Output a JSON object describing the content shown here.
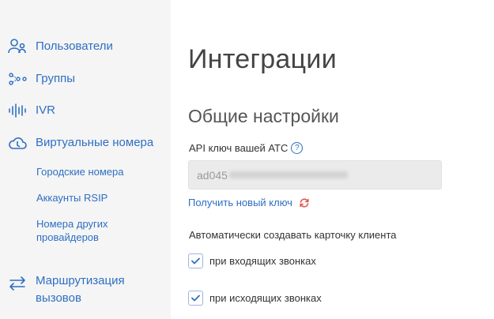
{
  "sidebar": {
    "items": [
      {
        "label": "Пользователи",
        "icon": "users-icon"
      },
      {
        "label": "Группы",
        "icon": "groups-icon"
      },
      {
        "label": "IVR",
        "icon": "ivr-waveform-icon"
      },
      {
        "label": "Виртуальные номера",
        "icon": "cloud-icon"
      },
      {
        "label": "Маршрутизация вызовов",
        "icon": "routing-arrows-icon"
      }
    ],
    "subitems": [
      "Городские номера",
      "Аккаунты RSIP",
      "Номера других провайдеров"
    ]
  },
  "main": {
    "title": "Интеграции",
    "section_title": "Общие настройки",
    "api_key_label": "API ключ вашей АТС",
    "help_glyph": "?",
    "api_key_value": "ad045",
    "new_key_link": "Получить новый ключ",
    "auto_create_label": "Автоматически создавать карточку клиента",
    "checkboxes": [
      {
        "label": "при входящих звонках",
        "checked": true
      },
      {
        "label": "при исходящих звонках",
        "checked": true
      }
    ]
  },
  "colors": {
    "accent": "#2e6fc3",
    "refresh": "#e05a4f",
    "sidebar_bg": "#f5f5f5"
  }
}
